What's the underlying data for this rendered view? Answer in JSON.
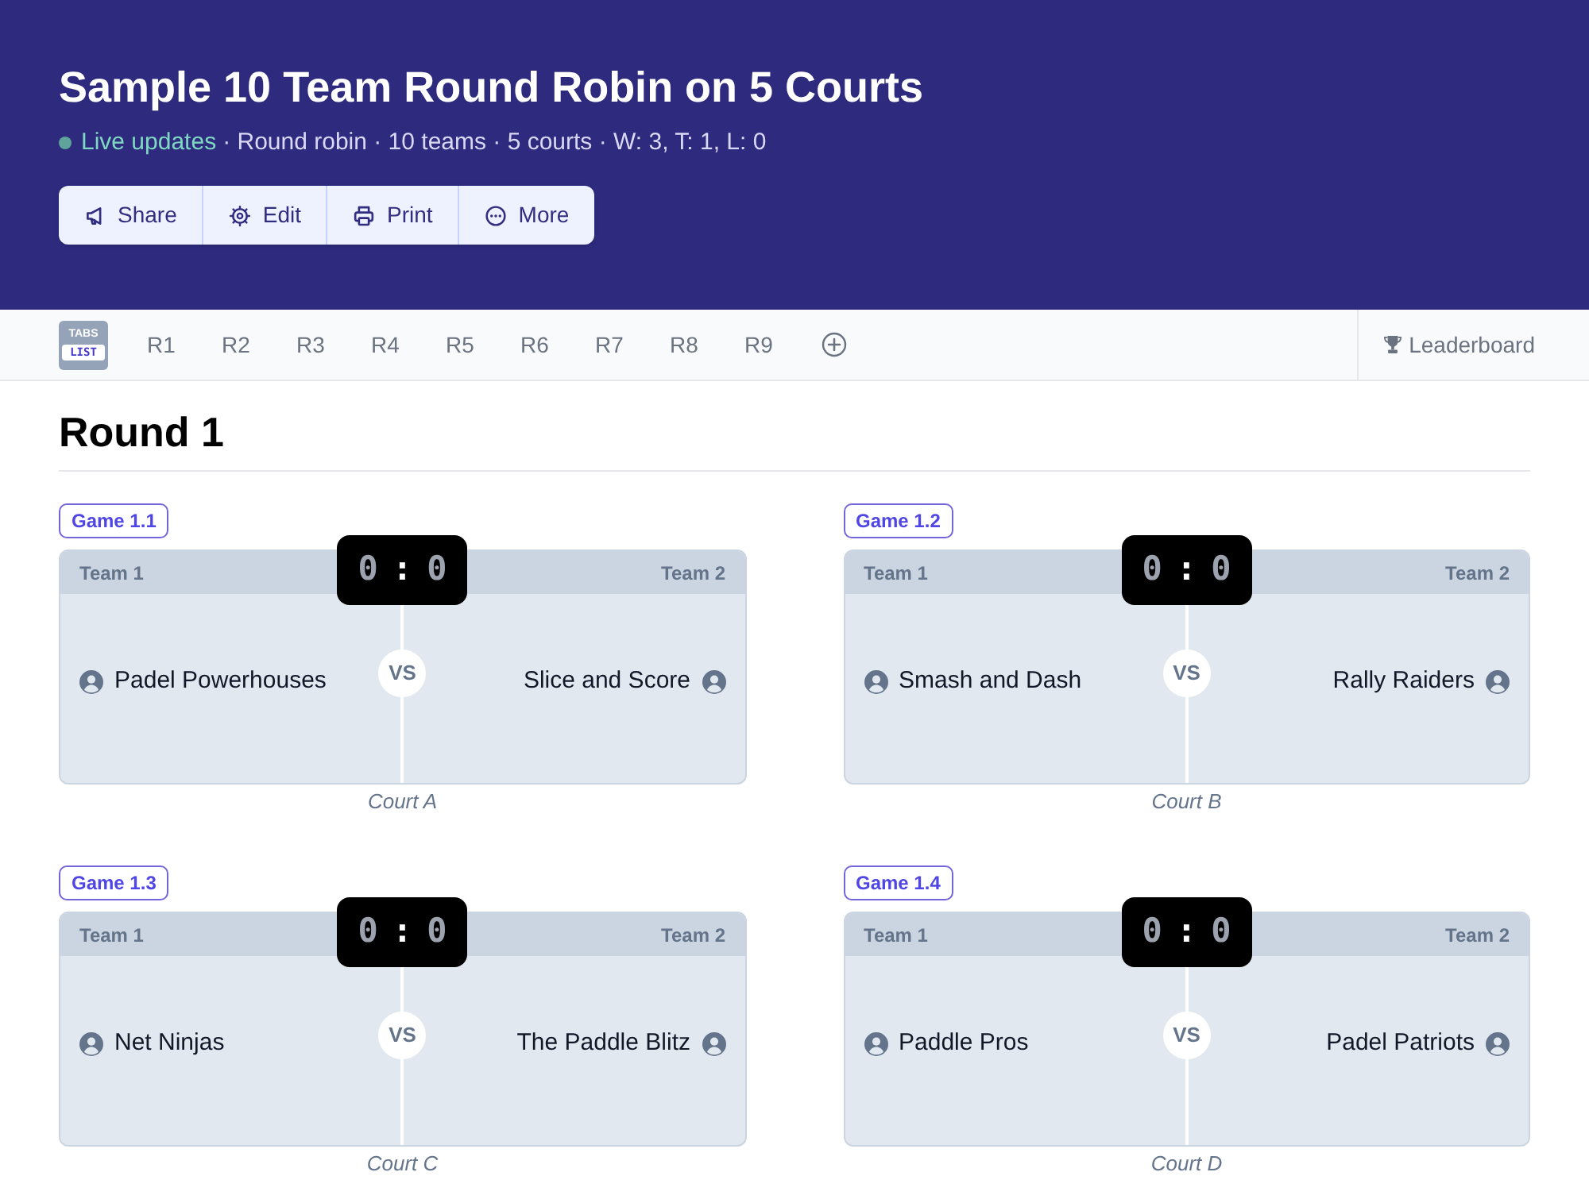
{
  "header": {
    "title": "Sample 10 Team Round Robin on 5 Courts",
    "live_label": "Live updates",
    "summary": "· Round robin · 10 teams · 5 courts · W: 3, T: 1, L: 0",
    "actions": [
      "Share",
      "Edit",
      "Print",
      "More"
    ]
  },
  "tab_bar": {
    "view_toggle": [
      "TABS",
      "LIST"
    ],
    "rounds": [
      "R1",
      "R2",
      "R3",
      "R4",
      "R5",
      "R6",
      "R7",
      "R8",
      "R9"
    ],
    "leaderboard": "Leaderboard"
  },
  "round": {
    "title": "Round 1",
    "games": [
      {
        "label": "Game 1.1",
        "team1_heading": "Team 1",
        "team2_heading": "Team 2",
        "score1": "0",
        "separator": ":",
        "score2": "0",
        "team1": "Padel Powerhouses",
        "vs": "VS",
        "team2": "Slice and Score",
        "court": "Court A"
      },
      {
        "label": "Game 1.2",
        "team1_heading": "Team 1",
        "team2_heading": "Team 2",
        "score1": "0",
        "separator": ":",
        "score2": "0",
        "team1": "Smash and Dash",
        "vs": "VS",
        "team2": "Rally Raiders",
        "court": "Court B"
      },
      {
        "label": "Game 1.3",
        "team1_heading": "Team 1",
        "team2_heading": "Team 2",
        "score1": "0",
        "separator": ":",
        "score2": "0",
        "team1": "Net Ninjas",
        "vs": "VS",
        "team2": "The Paddle Blitz",
        "court": "Court C"
      },
      {
        "label": "Game 1.4",
        "team1_heading": "Team 1",
        "team2_heading": "Team 2",
        "score1": "0",
        "separator": ":",
        "score2": "0",
        "team1": "Paddle Pros",
        "vs": "VS",
        "team2": "Padel Patriots",
        "court": "Court D"
      }
    ]
  }
}
